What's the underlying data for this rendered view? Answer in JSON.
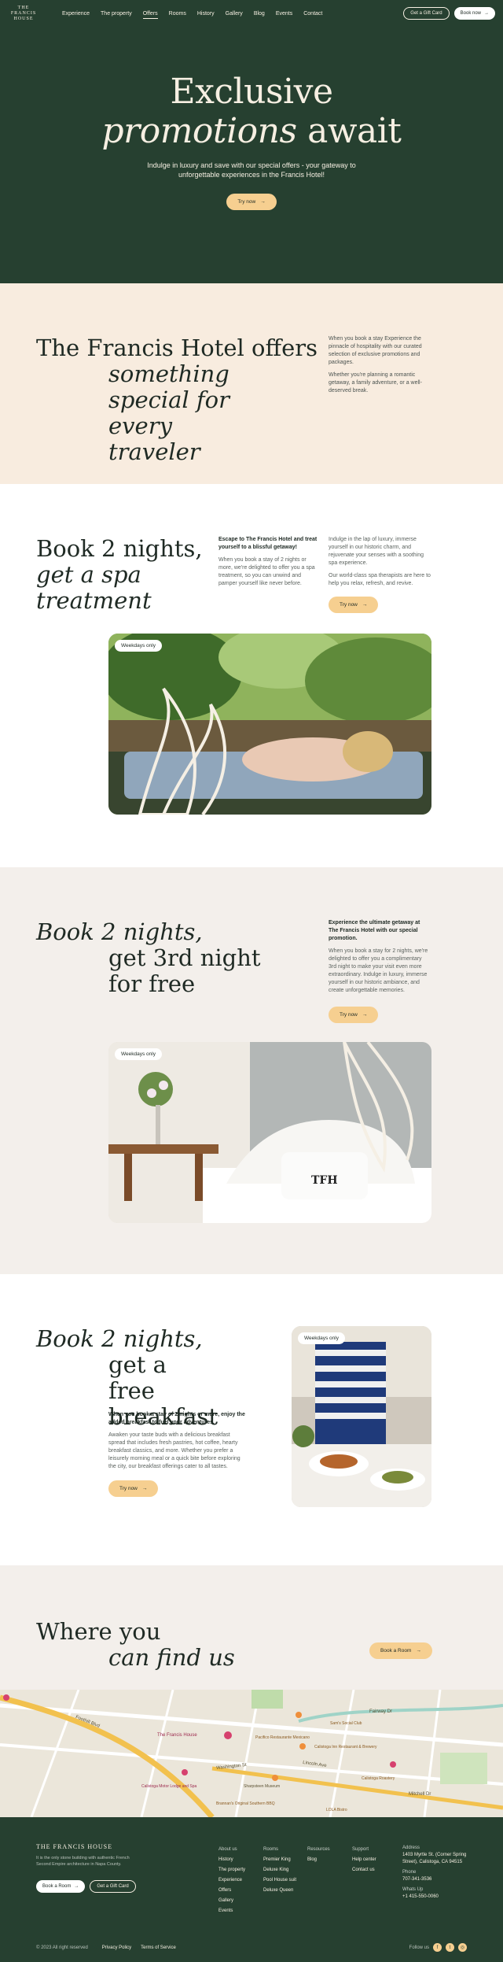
{
  "nav": {
    "logo_line1": "THE",
    "logo_line2": "FRANCIS",
    "logo_line3": "HOUSE",
    "links": [
      "Experience",
      "The property",
      "Offers",
      "Rooms",
      "History",
      "Gallery",
      "Blog",
      "Events",
      "Contact"
    ],
    "active": "Offers",
    "gift_card": "Get a Gift Card",
    "book_now": "Book now"
  },
  "hero": {
    "title_line1": "Exclusive",
    "title_italic": "promotions",
    "title_rest": "await",
    "subtitle": "Indulge in luxury and save with our special offers - your gateway to unforgettable experiences in the Francis Hotel!",
    "cta": "Try now"
  },
  "intro": {
    "title_line1": "The Francis Hotel offers",
    "title_italic": "something special for every traveler",
    "p1": "When you book a stay Experience the pinnacle of hospitality with our curated selection of exclusive promotions and packages.",
    "p2": "Whether you're planning a romantic getaway, a family adventure, or a well-deserved break."
  },
  "spa": {
    "title_line1": "Book 2 nights,",
    "title_italic": "get a spa treatment",
    "lead": "Escape to The Francis Hotel and treat yourself to a blissful getaway!",
    "p1": "When you book a stay of 2 nights or more, we're delighted to offer you a spa treatment, so you can unwind and pamper yourself like never before.",
    "p2": "Indulge in the lap of luxury, immerse yourself in our historic charm, and rejuvenate your senses with a soothing spa experience.",
    "p3": "Our world-class spa therapists are here to help you relax, refresh, and revive.",
    "cta": "Try now",
    "badge": "Weekdays only"
  },
  "third": {
    "title_italic": "Book 2 nights,",
    "title_rest": "get 3rd night for free",
    "lead": "Experience the ultimate getaway at The Francis Hotel with our special promotion.",
    "p1": "When you book a stay for 2 nights, we're delighted to offer you a complimentary 3rd night to make your visit even more extraordinary. Indulge in luxury, immerse yourself in our historic ambiance, and create unforgettable memories.",
    "cta": "Try now",
    "badge": "Weekdays only",
    "pillow_text": "TFH"
  },
  "breakfast": {
    "title_italic": "Book 2 nights,",
    "title_rest": "get a free breakfast",
    "lead": "When you book a stay of 2 nights or more, enjoy the added breakfast to fuel your adventures.",
    "p1": "Awaken your taste buds with a delicious breakfast spread that includes fresh pastries, hot coffee, hearty breakfast classics, and more. Whether you prefer a leisurely morning meal or a quick bite before exploring the city, our breakfast offerings cater to all tastes.",
    "cta": "Try now",
    "badge": "Weekdays only"
  },
  "find": {
    "title_line1": "Where you",
    "title_italic": "can find us",
    "cta": "Book a Room"
  },
  "map": {
    "labels": [
      "Foothill Blvd",
      "The Francis House",
      "Pacifico Restaurante Mexicano",
      "Lincoln Ave",
      "Washington St",
      "Sam's Social Club",
      "Calistoga Motor Lodge and Spa",
      "Brannan's Original Southern BBQ",
      "Sharpsteen Museum",
      "Calistoga Roastery",
      "Calistoga Inn Restaurant & Brewery",
      "Fairway Dr",
      "LOLA Bistro",
      "Mitchell Dr"
    ]
  },
  "footer": {
    "logo": "THE FRANCIS HOUSE",
    "tagline": "It is the only stone building with authentic French Second Empire architecture in Napa County.",
    "book_room": "Book a Room",
    "gift_card": "Get a Gift Card",
    "col1": [
      "About us",
      "History",
      "The property",
      "Experience",
      "Offers",
      "Gallery",
      "Events"
    ],
    "col2": [
      "Rooms",
      "Premier King",
      "Deluxe King",
      "Pool House suit",
      "Deluxe Queen"
    ],
    "col3": [
      "Resources",
      "Blog"
    ],
    "col4": [
      "Support",
      "Help center",
      "Contact us"
    ],
    "address_h": "Address",
    "address": "1403 Myrtle St. (Corner Spring Street), Calistoga, CA 94515",
    "phone_h": "Phone",
    "phone": "707-341-3536",
    "wa_h": "Whats Up",
    "wa": "+1 415-550-0060",
    "copyright": "© 2023 All right reserved",
    "privacy": "Privacy Policy",
    "terms": "Terms of Service",
    "follow": "Follow us"
  },
  "colors": {
    "green": "#264030",
    "cream": "#f8ecdf",
    "beige": "#f3efeb",
    "yellow": "#f6cf90"
  }
}
